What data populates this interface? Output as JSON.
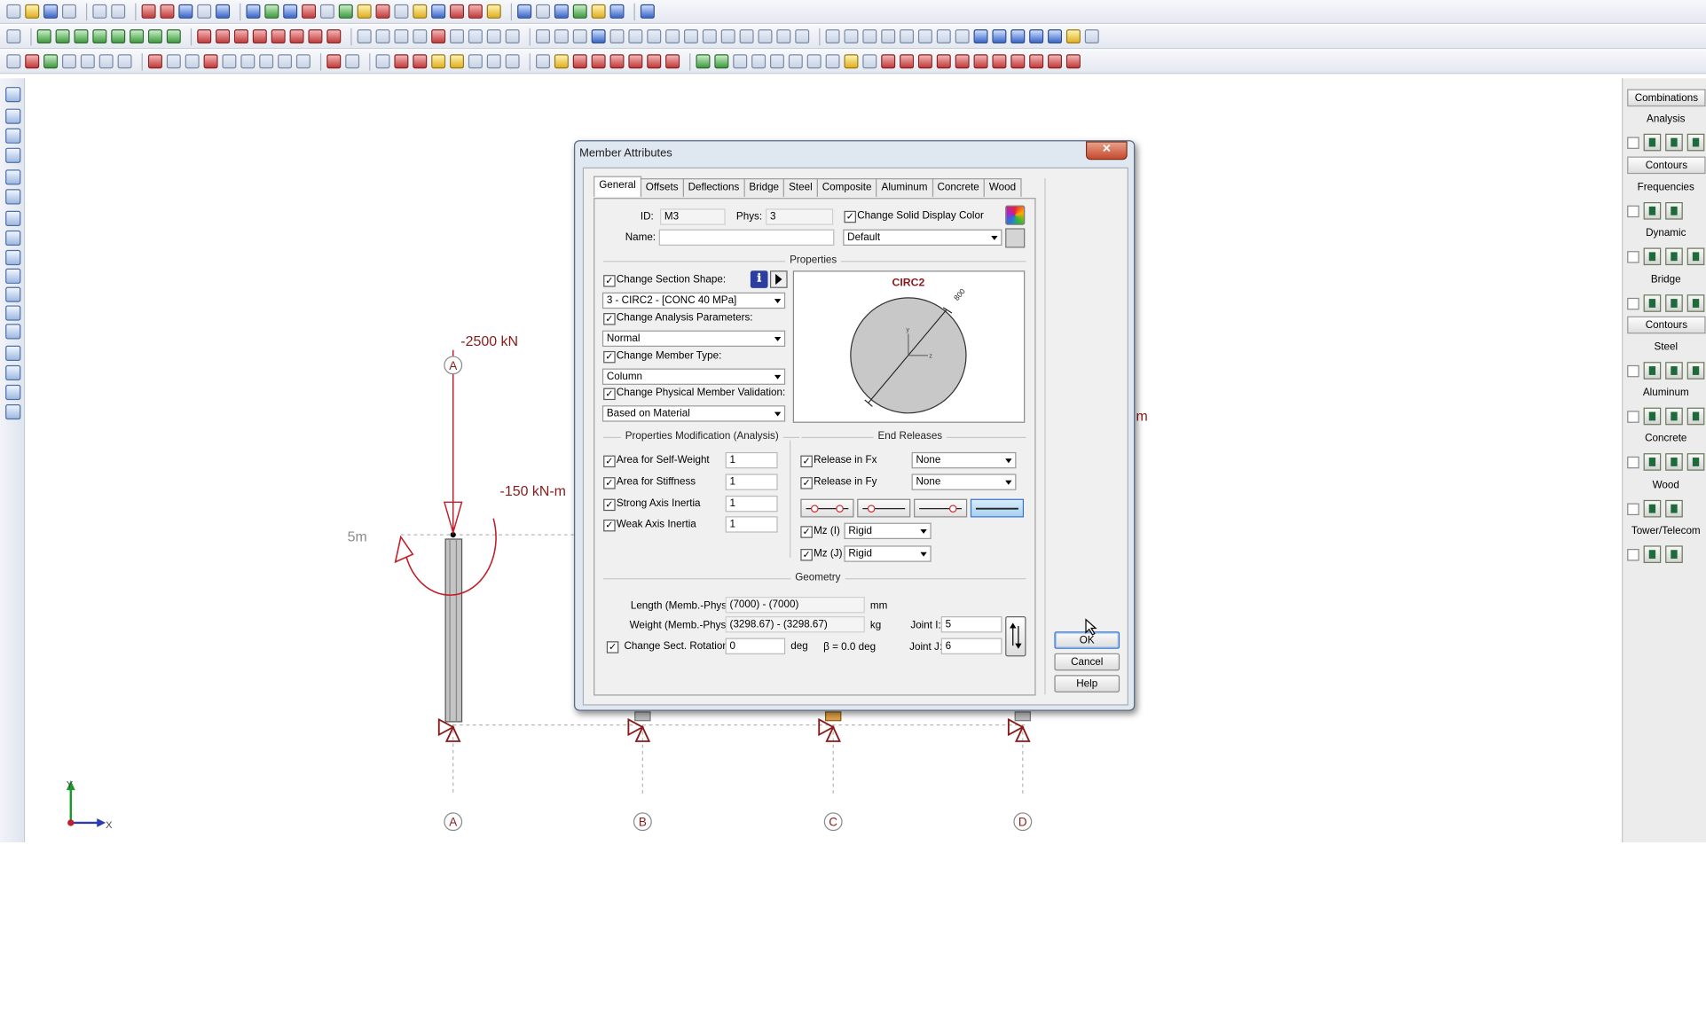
{
  "canvas": {
    "load_axial": "-2500 kN",
    "load_moment": "-150 kN-m",
    "load_moment_right": "m",
    "elevation": "5m",
    "grid_labels": [
      "A",
      "B",
      "C",
      "D"
    ],
    "top_grid_label": "A",
    "axis_y": "Y",
    "axis_x": "X"
  },
  "right_panel": {
    "combinations": "Combinations",
    "analysis": "Analysis",
    "contours_1": "Contours",
    "frequencies": "Frequencies",
    "dynamic": "Dynamic",
    "bridge": "Bridge",
    "contours_2": "Contours",
    "steel": "Steel",
    "aluminum": "Aluminum",
    "concrete": "Concrete",
    "wood": "Wood",
    "tower": "Tower/Telecom"
  },
  "dialog": {
    "title": "Member Attributes",
    "close": "✕",
    "tabs": [
      "General",
      "Offsets",
      "Deflections",
      "Bridge",
      "Steel",
      "Composite",
      "Aluminum",
      "Concrete",
      "Wood"
    ],
    "id_label": "ID:",
    "id_value": "M3",
    "phys_label": "Phys:",
    "phys_value": "3",
    "name_label": "Name:",
    "name_value": "",
    "change_color": "Change Solid Display Color",
    "color_value": "Default",
    "properties_group": "Properties",
    "change_section_shape": "Change Section Shape:",
    "section_shape_value": "3 - CIRC2 - [CONC 40 MPa]",
    "change_analysis": "Change Analysis Parameters:",
    "analysis_value": "Normal",
    "change_member_type": "Change Member Type:",
    "member_type_value": "Column",
    "change_validation": "Change Physical Member Validation:",
    "validation_value": "Based on Material",
    "section_name": "CIRC2",
    "section_dim": "800",
    "section_axis_y": "y",
    "section_axis_z": "z",
    "prop_mod_group": "Properties Modification (Analysis)",
    "area_self_weight": "Area for Self-Weight",
    "area_self_weight_value": "1",
    "area_stiffness": "Area for Stiffness",
    "area_stiffness_value": "1",
    "strong_axis": "Strong Axis Inertia",
    "strong_axis_value": "1",
    "weak_axis": "Weak Axis Inertia",
    "weak_axis_value": "1",
    "end_releases_group": "End Releases",
    "release_fx": "Release in Fx",
    "release_fx_value": "None",
    "release_fy": "Release in Fy",
    "release_fy_value": "None",
    "mz_i": "Mz (I)",
    "mz_i_value": "Rigid",
    "mz_j": "Mz (J)",
    "mz_j_value": "Rigid",
    "geometry_group": "Geometry",
    "length_label": "Length (Memb.-Phys.)",
    "length_value": "(7000) - (7000)",
    "length_unit": "mm",
    "weight_label": "Weight (Memb.-Phys.)",
    "weight_value": "(3298.67) - (3298.67)",
    "weight_unit": "kg",
    "change_rotation": "Change Sect. Rotation:",
    "rotation_value": "0",
    "rotation_unit": "deg",
    "beta": "β = 0.0 deg",
    "joint_i_label": "Joint I:",
    "joint_i_value": "5",
    "joint_j_label": "Joint J:",
    "joint_j_value": "6",
    "ok": "OK",
    "cancel": "Cancel",
    "help": "Help"
  }
}
